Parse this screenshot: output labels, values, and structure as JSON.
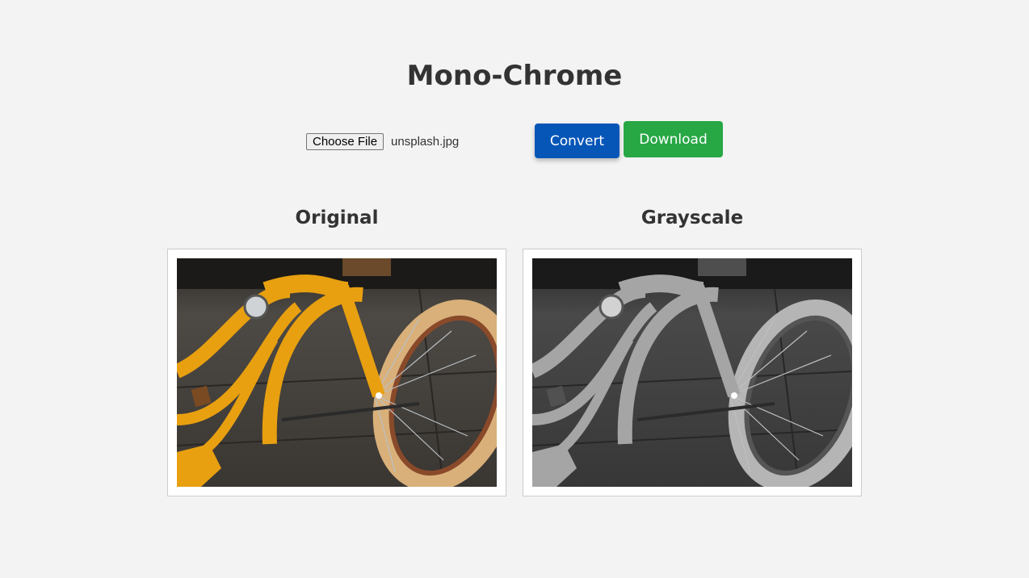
{
  "app": {
    "title": "Mono-Chrome"
  },
  "controls": {
    "choose_file_label": "Choose File",
    "selected_file": "unsplash.jpg",
    "convert_label": "Convert",
    "download_label": "Download"
  },
  "panels": [
    {
      "title": "Original",
      "filter": "none"
    },
    {
      "title": "Grayscale",
      "filter": "grayscale"
    }
  ],
  "colors": {
    "background": "#f3f3f3",
    "convert_button": "#0656b8",
    "download_button": "#28a745",
    "text": "#333333",
    "bike_frame": "#e8a010",
    "tire": "#d9b07a"
  }
}
